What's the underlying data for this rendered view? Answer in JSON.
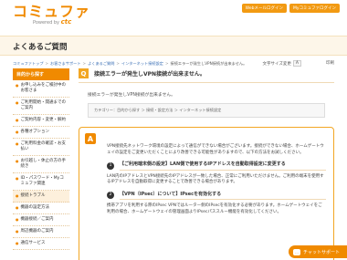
{
  "header": {
    "logo_main": "コミュファ",
    "logo_sub_prefix": "Powered by",
    "logo_sub_brand": "ctc",
    "btn_web": "Webメールログイン",
    "btn_my": "Myコミュファログイン"
  },
  "band": {
    "title": "よくあるご質問"
  },
  "breadcrumb": {
    "items": [
      "コミュファトップ",
      "お客さまサポート",
      "よくあるご質問",
      "インターネット接続設定"
    ],
    "current": "接続エラーが発生しVPN接続が出来ません。"
  },
  "toolbar": {
    "fontsize_label": "文字サイズ変更",
    "fontsize_btn": "A",
    "print_label": "印刷"
  },
  "sidebar": {
    "head": "目的から探す",
    "items": [
      "お申し込みをご検討中のお客さま",
      "ご利用開始・開通までのご案内",
      "ご契約内容・変更・解約",
      "各種オプション",
      "ご利用料金の確認・お支払い",
      "お引越し・休止の方の手続き",
      "ID・パスワード・Myコミュファ関連",
      "接続トラブル",
      "機器の設定方法",
      "機器接続／ご案内",
      "周辺機器のご案内",
      "通信サービス"
    ],
    "active_index": 7
  },
  "question": {
    "badge": "Q",
    "title": "接続エラーが発生しVPN接続が出来ません。",
    "body": "接続エラーが発生しVPN接続が出来ません。",
    "category": "カテゴリー：目的から探す ＞ 接続・設定方法 ＞ インターネット接続設定"
  },
  "answer": {
    "badge": "A",
    "intro": "VPN接続先ネットワーク環境の設定によって通信ができない場合がございます。接続ができない場合、ホームゲートウェイの設定をご変更いただくことにより改善できる可能性がありますので、以下の方法をお試しください。",
    "s1_num": "1",
    "s1_heading": "【ご利用端末側の設定】LAN側で使用するIPアドレスを自動取得設定に変更する",
    "s1_text": "LAN内のIPアドレスとVPN接続先のIPアドレスが一致した場合、正常にご利用いただけません。ご利用の端末を使用するIPアドレスを自動取得に変更することで改善できる場合があります。",
    "s2_num": "2",
    "s2_heading": "【VPN（IPsec）について】IPsecを有効化する",
    "s2_text": "携帯アプリを利用する際のIPsec VPNではルーター側のIPsecを有効化する必要があります。ホームゲートウェイをご利用の場合、ホームゲートウェイの管理画面よりIPsecパススルー機能を有効化してください。"
  },
  "chat": {
    "label": "チャットサポート"
  },
  "colors": {
    "accent": "#f08a00",
    "badge_q": "#f2a623",
    "band": "#fdf6e9"
  }
}
